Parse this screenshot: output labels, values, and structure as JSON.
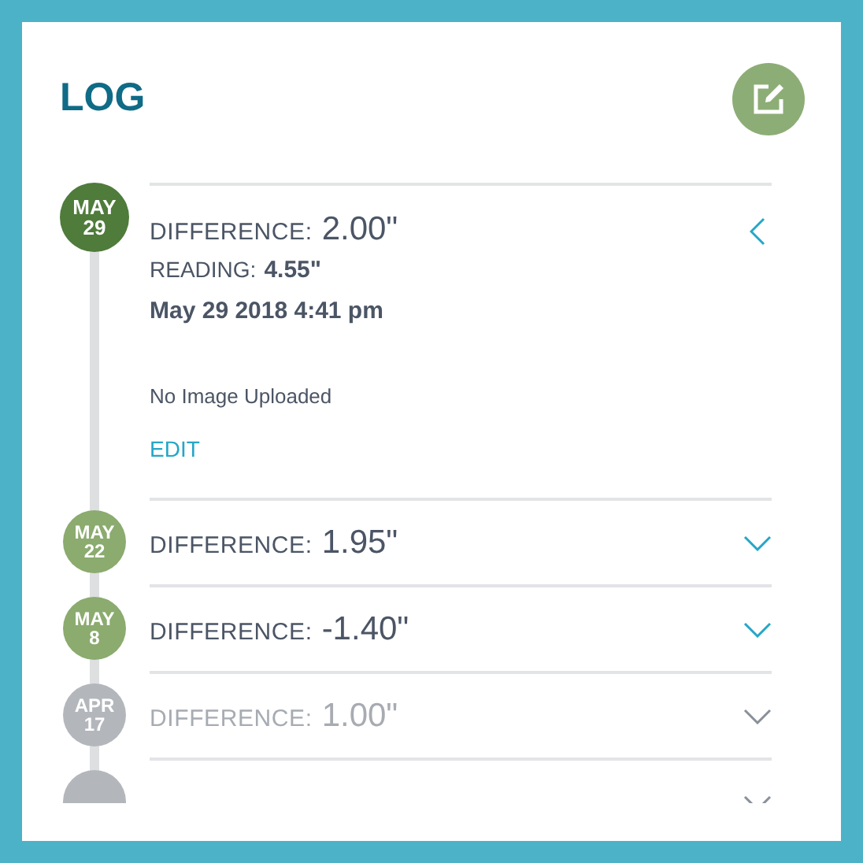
{
  "header": {
    "title": "LOG"
  },
  "entries": [
    {
      "month": "MAY",
      "day": "29",
      "difference_label": "DIFFERENCE:",
      "difference": "2.00\"",
      "expanded": true,
      "faded": false,
      "reading_label": "READING:",
      "reading": "4.55\"",
      "timestamp": "May 29 2018 4:41 pm",
      "image_status": "No Image Uploaded",
      "edit_link": "EDIT"
    },
    {
      "month": "MAY",
      "day": "22",
      "difference_label": "DIFFERENCE:",
      "difference": "1.95\"",
      "expanded": false,
      "faded": false
    },
    {
      "month": "MAY",
      "day": "8",
      "difference_label": "DIFFERENCE:",
      "difference": "-1.40\"",
      "expanded": false,
      "faded": false
    },
    {
      "month": "APR",
      "day": "17",
      "difference_label": "DIFFERENCE:",
      "difference": "1.00\"",
      "expanded": false,
      "faded": true
    },
    {
      "expanded": false,
      "faded": true
    }
  ]
}
